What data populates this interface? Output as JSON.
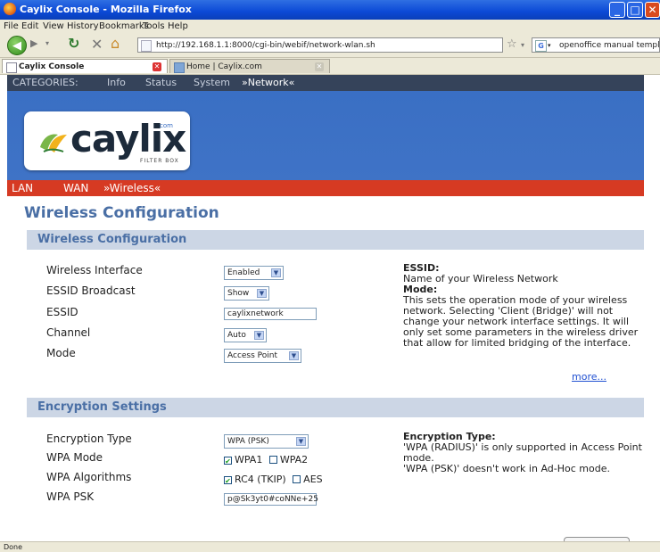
{
  "window": {
    "title": "Caylix Console - Mozilla Firefox"
  },
  "menu": [
    "File",
    "Edit",
    "View",
    "History",
    "Bookmarks",
    "Tools",
    "Help"
  ],
  "navbar": {
    "url": "http://192.168.1.1:8000/cgi-bin/webif/network-wlan.sh",
    "search_value": "openoffice manual templates"
  },
  "tabs": [
    {
      "label": "Caylix Console"
    },
    {
      "label": "Home | Caylix.com"
    }
  ],
  "categories": {
    "heading": "CATEGORIES:",
    "items": [
      "Info",
      "Status",
      "System",
      "»Network«"
    ]
  },
  "logo": {
    "brand": "caylix",
    "com": "com",
    "sub": "FILTER BOX"
  },
  "subnav": [
    "LAN",
    "WAN",
    "»Wireless«"
  ],
  "page_title": "Wireless Configuration",
  "wireless": {
    "section_title": "Wireless Configuration",
    "fields": {
      "interface": {
        "label": "Wireless Interface",
        "value": "Enabled"
      },
      "broadcast": {
        "label": "ESSID Broadcast",
        "value": "Show"
      },
      "essid": {
        "label": "ESSID",
        "value": "caylixnetwork"
      },
      "channel": {
        "label": "Channel",
        "value": "Auto"
      },
      "mode": {
        "label": "Mode",
        "value": "Access Point"
      }
    },
    "help": {
      "essid_title": "ESSID:",
      "essid_text": "Name of your Wireless Network",
      "mode_title": "Mode:",
      "mode_text": "This sets the operation mode of your wireless network. Selecting 'Client (Bridge)' will not change your network interface settings. It will only set some parameters in the wireless driver that allow for limited bridging of the interface.",
      "more_link": "more..."
    }
  },
  "encryption": {
    "section_title": "Encryption Settings",
    "fields": {
      "type": {
        "label": "Encryption Type",
        "value": "WPA (PSK)"
      },
      "wpa_mode": {
        "label": "WPA Mode",
        "opt1": "WPA1",
        "opt2": "WPA2"
      },
      "algorithms": {
        "label": "WPA Algorithms",
        "opt1": "RC4 (TKIP)",
        "opt2": "AES"
      },
      "psk": {
        "label": "WPA PSK",
        "value": "p@Sk3yt0#coNNe+25"
      }
    },
    "help": {
      "title": "Encryption Type:",
      "text1": "'WPA (RADIUS)' is only supported in Access Point mode.",
      "text2": "'WPA (PSK)' doesn't work in Ad-Hoc mode."
    }
  },
  "status": {
    "text": "Done"
  }
}
